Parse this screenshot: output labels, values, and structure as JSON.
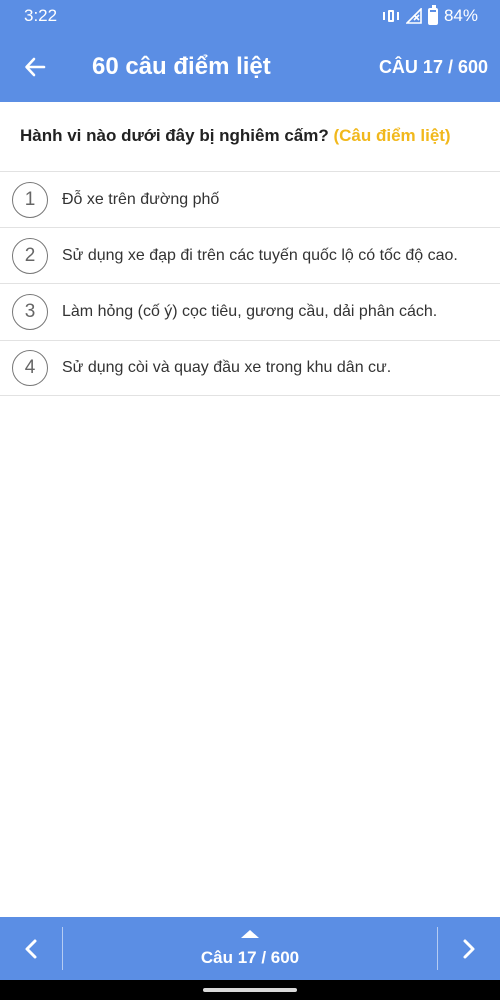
{
  "status_bar": {
    "time": "3:22",
    "battery": "84%",
    "icons": [
      "vibrate-icon",
      "signal-icon",
      "battery-icon"
    ]
  },
  "app_bar": {
    "back_icon": "arrow-left-icon",
    "title": "60 câu điểm liệt",
    "counter": "CÂU 17 / 600"
  },
  "question": {
    "text": "Hành vi nào dưới đây bị nghiêm cấm?",
    "tag": "(Câu điểm liệt)"
  },
  "answers": [
    {
      "number": "1",
      "text": "Đỗ xe trên đường phố"
    },
    {
      "number": "2",
      "text": "Sử dụng xe đạp đi trên các tuyến quốc lộ có tốc độ cao."
    },
    {
      "number": "3",
      "text": "Làm hỏng (cố ý) cọc tiêu, gương cầu, dải phân cách."
    },
    {
      "number": "4",
      "text": "Sử dụng còi và quay đầu xe trong khu dân cư."
    }
  ],
  "bottom_bar": {
    "prev_icon": "chevron-left-icon",
    "expand_icon": "caret-up-icon",
    "label": "Câu 17 / 600",
    "next_icon": "chevron-right-icon"
  },
  "colors": {
    "primary": "#5b8ee4",
    "highlight": "#f1b81c",
    "divider": "#e2e2e2"
  }
}
